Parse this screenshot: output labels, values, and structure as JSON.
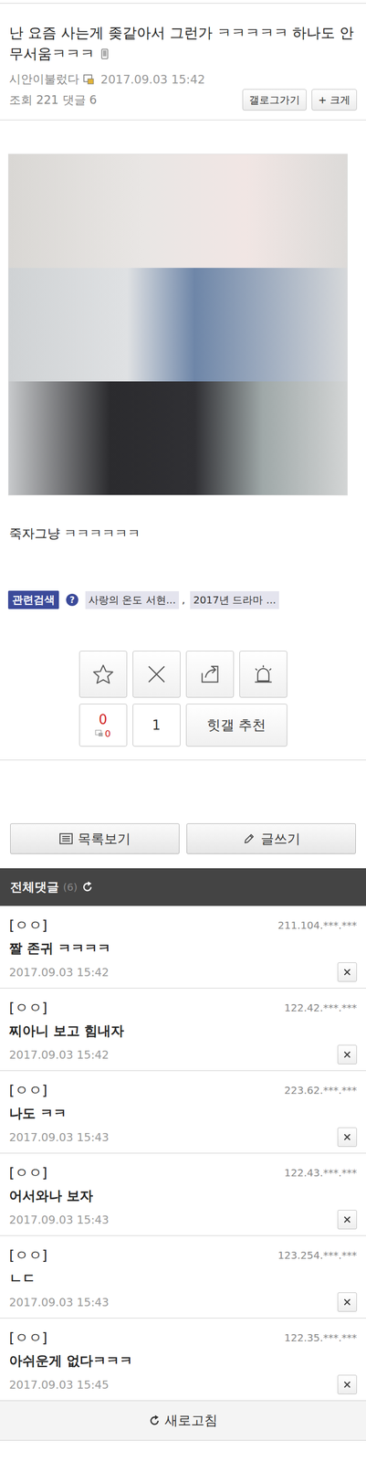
{
  "post": {
    "title": "난 요즘 사는게 좆같아서 그런가 ㅋㅋㅋㅋㅋ 하나도 안무서움ㅋㅋㅋ",
    "author": "시안이불렀다",
    "date": "2017.09.03 15:42",
    "views_label": "조회",
    "views": "221",
    "comments_label": "댓글",
    "comments": "6",
    "buttons": [
      "갤로그가기",
      "+ 크게"
    ],
    "body": "죽자그냥 ㅋㅋㅋㅋㅋㅋ"
  },
  "related": {
    "label": "관련검색",
    "help": "?",
    "separator": ",",
    "tags": [
      "사랑의 온도 서현...",
      "2017년 드라마 ..."
    ]
  },
  "vote": {
    "recommend": "0",
    "fix_recommend": "0",
    "not_recommend": "1",
    "hit": "힛갤 추천"
  },
  "actions": [
    "목록보기",
    "글쓰기"
  ],
  "comments_header": {
    "label": "전체댓글",
    "count": "(6)"
  },
  "comments": [
    {
      "name": "[ㅇㅇ]",
      "ip": "211.104.***.***",
      "text": "짤 존귀 ㅋㅋㅋㅋ",
      "date": "2017.09.03 15:42"
    },
    {
      "name": "[ㅇㅇ]",
      "ip": "122.42.***.***",
      "text": "찌아니 보고 힘내자",
      "date": "2017.09.03 15:42"
    },
    {
      "name": "[ㅇㅇ]",
      "ip": "223.62.***.***",
      "text": "나도 ㅋㅋ",
      "date": "2017.09.03 15:43"
    },
    {
      "name": "[ㅇㅇ]",
      "ip": "122.43.***.***",
      "text": "어서와나 보자",
      "date": "2017.09.03 15:43"
    },
    {
      "name": "[ㅇㅇ]",
      "ip": "123.254.***.***",
      "text": "ㄴㄷ",
      "date": "2017.09.03 15:43"
    },
    {
      "name": "[ㅇㅇ]",
      "ip": "122.35.***.***",
      "text": "아쉬운게 없다ㅋㅋㅋ",
      "date": "2017.09.03 15:45"
    }
  ],
  "refresh": "새로고침"
}
